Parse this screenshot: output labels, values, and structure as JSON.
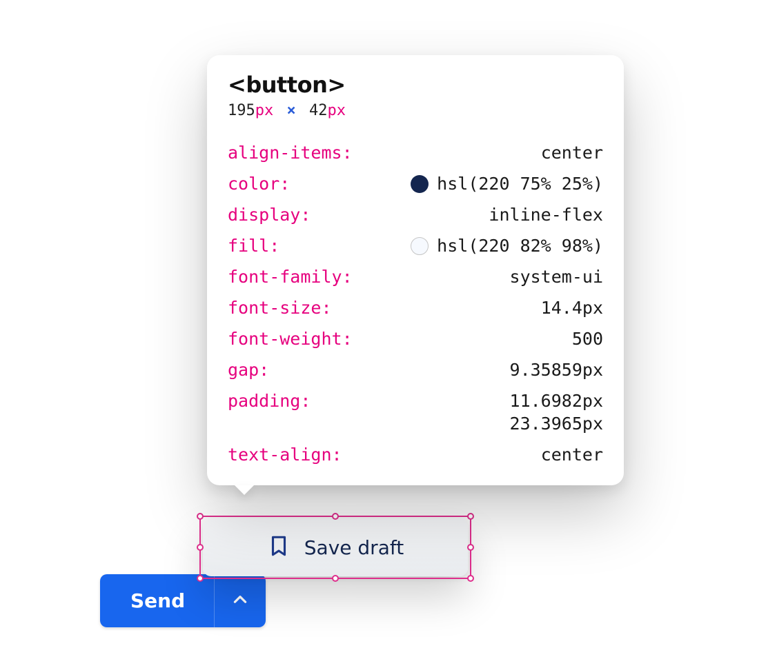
{
  "inspector": {
    "tag": "<button>",
    "width_value": "195",
    "width_unit": "px",
    "separator": "×",
    "height_value": "42",
    "height_unit": "px",
    "props": {
      "align_items": {
        "label": "align-items",
        "value": "center"
      },
      "color": {
        "label": "color",
        "value": "hsl(220 75% 25%)",
        "swatch": "#14264f"
      },
      "display": {
        "label": "display",
        "value": "inline-flex"
      },
      "fill": {
        "label": "fill",
        "value": "hsl(220 82% 98%)",
        "swatch": "#f6f9fe",
        "stroke": true
      },
      "font_family": {
        "label": "font-family",
        "value": "system-ui"
      },
      "font_size": {
        "label": "font-size",
        "value": "14.4px"
      },
      "font_weight": {
        "label": "font-weight",
        "value": "500"
      },
      "gap": {
        "label": "gap",
        "value": "9.35859px"
      },
      "padding": {
        "label": "padding",
        "value1": "11.6982px",
        "value2": "23.3965px"
      },
      "text_align": {
        "label": "text-align",
        "value": "center"
      }
    }
  },
  "save_draft": {
    "label": "Save draft"
  },
  "send": {
    "label": "Send"
  }
}
